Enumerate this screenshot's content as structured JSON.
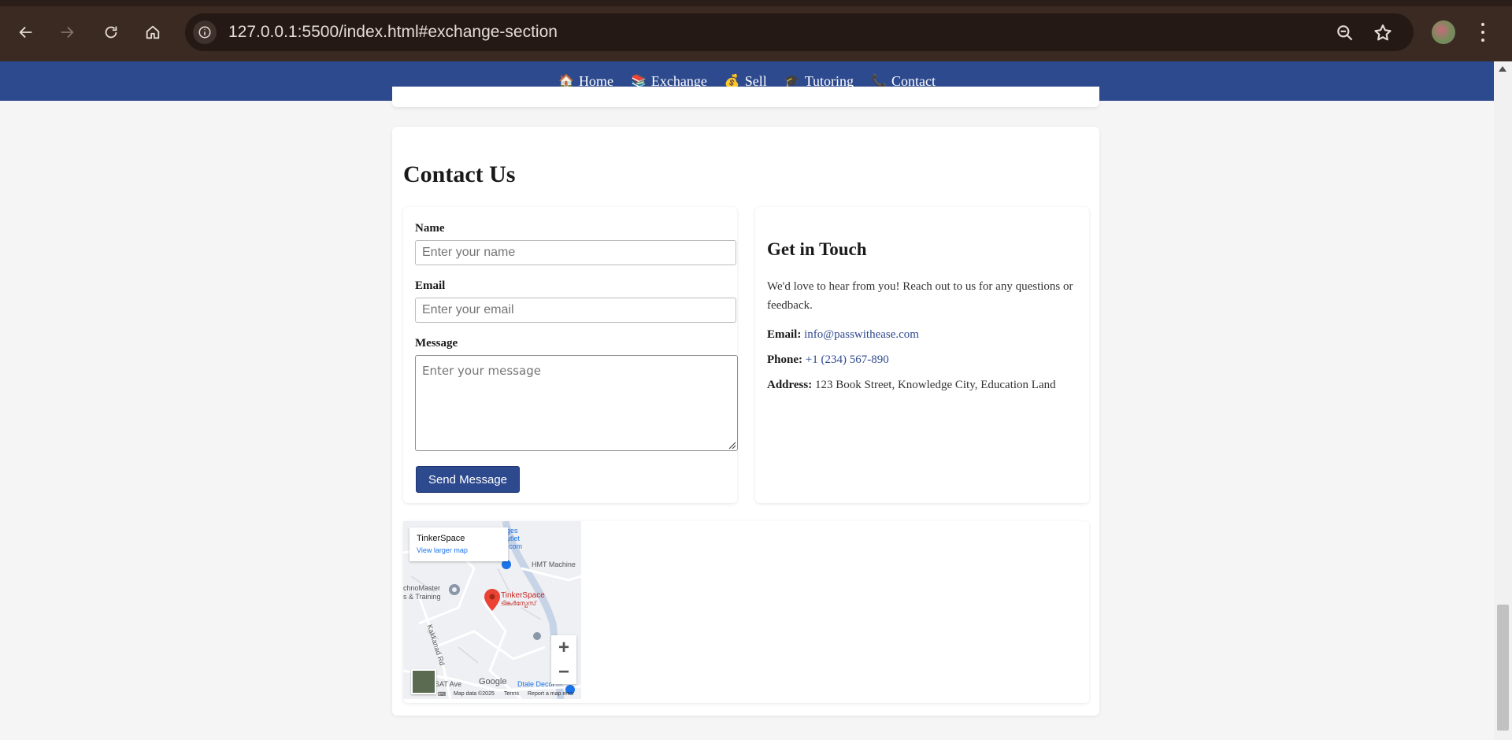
{
  "browser": {
    "url": "127.0.0.1:5500/index.html#exchange-section"
  },
  "nav": {
    "items": [
      {
        "icon": "🏠",
        "label": "Home"
      },
      {
        "icon": "📚",
        "label": "Exchange"
      },
      {
        "icon": "💰",
        "label": "Sell"
      },
      {
        "icon": "🎓",
        "label": "Tutoring"
      },
      {
        "icon": "📞",
        "label": "Contact"
      }
    ]
  },
  "contact": {
    "title": "Contact Us",
    "form": {
      "name_label": "Name",
      "name_placeholder": "Enter your name",
      "email_label": "Email",
      "email_placeholder": "Enter your email",
      "message_label": "Message",
      "message_placeholder": "Enter your message",
      "submit_label": "Send Message"
    },
    "touch": {
      "title": "Get in Touch",
      "text": "We'd love to hear from you! Reach out to us for any questions or feedback.",
      "email_label": "Email:",
      "email_value": "info@passwithease.com",
      "phone_label": "Phone:",
      "phone_value": "+1 (234) 567-890",
      "address_label": "Address:",
      "address_value": "123 Book Street, Knowledge City, Education Land"
    }
  },
  "map": {
    "place_name": "TinkerSpace",
    "view_larger": "View larger map",
    "pin_label": "TinkerSpace",
    "pin_sublabel": "ടിങ്കർസ്പേസ്",
    "label_hmt": "HMT Machine",
    "label_technomaster_1": "chnoMaster",
    "label_technomaster_2": "s & Training",
    "label_road": "Kakkanad Rd",
    "label_ages": "ges",
    "label_utlet": "utlet",
    "label_com": "com",
    "label_sat": "SAT Ave",
    "label_dtale": "Dtale Decor",
    "google": "Google",
    "map_data": "Map data ©2025",
    "terms": "Terms",
    "report": "Report a map error",
    "zoom_in": "+",
    "zoom_out": "−"
  }
}
